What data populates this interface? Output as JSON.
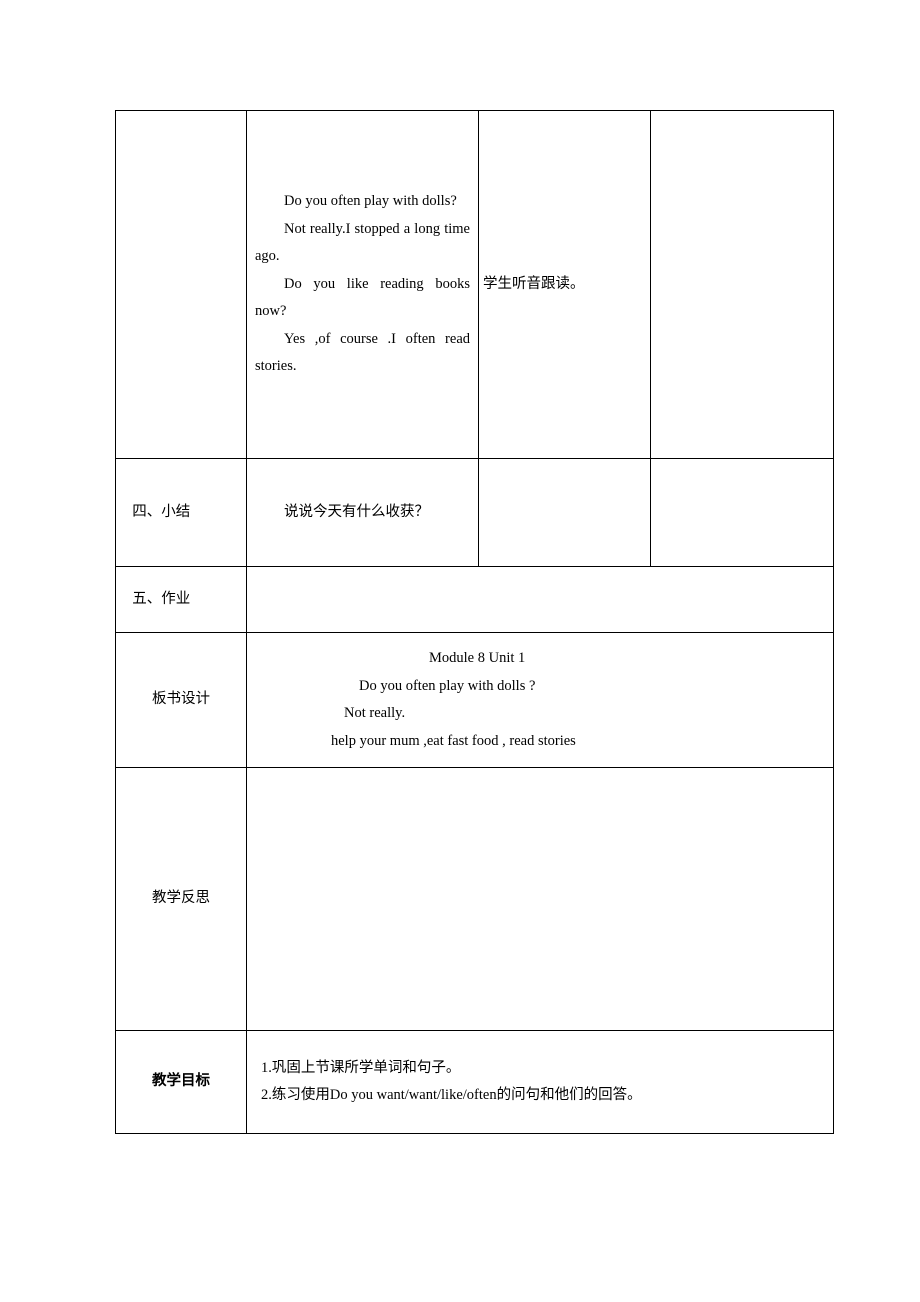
{
  "row1": {
    "col2_lines": [
      "Do you often play with dolls?",
      "Not really.I stopped a long time ago.",
      "Do you like reading books now?",
      "Yes ,of course .I often read stories."
    ],
    "col3": "学生听音跟读。"
  },
  "row2": {
    "label": "四、小结",
    "content": "说说今天有什么收获？"
  },
  "row3": {
    "label": "五、作业"
  },
  "row4": {
    "label": "板书设计",
    "lines": [
      "Module 8 Unit 1",
      "Do you often play with dolls ?",
      "Not really.",
      "help your mum ,eat fast food , read stories"
    ]
  },
  "row5": {
    "label": "教学反思"
  },
  "row6": {
    "label": "教学目标",
    "lines": [
      "1.巩固上节课所学单词和句子。",
      "2.练习使用Do you want/want/like/often的问句和他们的回答。"
    ]
  }
}
